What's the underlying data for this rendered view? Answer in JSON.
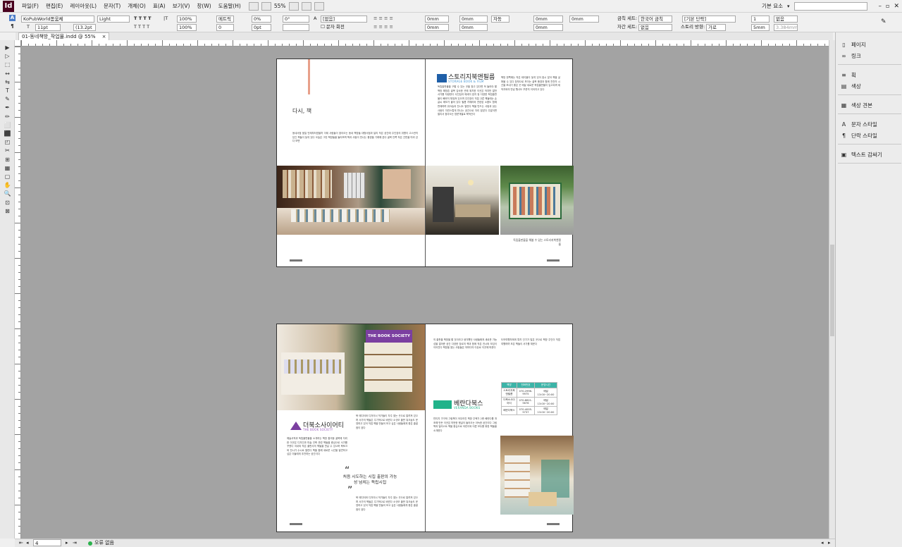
{
  "app": {
    "logo": "Id",
    "workspace": "기본 요소",
    "search_placeholder": "",
    "zoom": "55%"
  },
  "menu": [
    "파일(F)",
    "편집(E)",
    "레이아웃(L)",
    "문자(T)",
    "개체(O)",
    "표(A)",
    "보기(V)",
    "창(W)",
    "도움말(H)"
  ],
  "control": {
    "font_family": "KoPubWorld돋움체",
    "font_style": "Light",
    "font_size": "11pt",
    "leading": "(13.2pt",
    "scale_v": "100%",
    "scale_h": "100%",
    "kerning": "메트릭",
    "tracking": "0",
    "tsume": "0%",
    "baseline": "0pt",
    "skew": "0°",
    "lang_label": "A",
    "lang_value": "[없음]",
    "char_rotate": "문자 회전",
    "indent_left": "0mm",
    "indent_right": "0mm",
    "indent_first": "0mm",
    "indent_last": "0mm",
    "auto": "자동",
    "space_before": "0mm",
    "space_after": "0mm",
    "extra1": "0mm",
    "extra2": "0mm",
    "kinsoku_label": "금칙 세트:",
    "kinsoku_value": "한국어 금칙",
    "mojikumi_label": "자간 세트:",
    "mojikumi_value": "없음",
    "para_style": "[기본 단락]",
    "story_label": "스토리 방향:",
    "story_value": "가로",
    "columns": "1",
    "gutter": "5mm",
    "none": "없음",
    "width_val": "3.384mm"
  },
  "document": {
    "tab": "01-동네책방_작업물.indd @ 55%"
  },
  "tools": [
    "▶",
    "▷",
    "⬚",
    "↔",
    "⇆",
    "T",
    "✎",
    "✒",
    "✏",
    "⬜",
    "⬛",
    "◰",
    "✂",
    "⊞",
    "▦",
    "▢",
    "✋",
    "🔍",
    "⊡",
    "⊠"
  ],
  "panels": {
    "groups": [
      [
        {
          "icon": "▯",
          "label": "페이지"
        },
        {
          "icon": "∞",
          "label": "링크"
        }
      ],
      [
        {
          "icon": "≡",
          "label": "획"
        },
        {
          "icon": "▤",
          "label": "색상"
        }
      ],
      [
        {
          "icon": "▦",
          "label": "색상 견본"
        }
      ],
      [
        {
          "icon": "A",
          "label": "문자 스타일"
        },
        {
          "icon": "¶",
          "label": "단락 스타일"
        }
      ],
      [
        {
          "icon": "▣",
          "label": "텍스트 감싸기"
        }
      ]
    ]
  },
  "spread1": {
    "title": "다시, 책",
    "intro": "동네서점 붐일 언제부터였을까 이제 사람들이 찾아오는 동네 책방들 대형서점과 달리 작은 공간에 주인장의 취향이 고스란히 담긴 책들이 놓여 있다 오늘은 그런 책방들을 둘러보며 책과 사람이 만나는 풍경을 기록해 본다 골목 안쪽 작은 간판을 따라 걷다 보면",
    "store1_name": "스토리지북앤필름",
    "store1_sub": "STORAGE BOOK & FILM",
    "store1_text": "독립출판물을 구할 수 있는 곳을 찾고 있다면 꼭 들러야 할 책방 해방촌 골목 깊숙한 곳에 위치한 이곳은 작지만 알찬 서가를 자랑한다 사진집과 에세이 잡지 등 다양한 독립출판물이 빼곡히 채워져 있으며 주인장이 직접 고른 책들에는 손글씨 메모가 붙어 있다 필름 카메라와 관련된 소품도 함께 판매하며 워크숍과 전시도 열린다 책을 만드는 사람과 읽는 사람이 자연스럽게 만나는 공간으로 자리 잡았다 주말이면 멀리서 찾아오는 방문객들로 북적인다",
    "store1_text2": "책방 한쪽에는 작은 테이블이 놓여 있어 잠시 앉아 책을 살펴볼 수 있다 창밖으로 보이는 골목 풍경과 함께 천천히 시간을 보내기 좋은 곳 매달 새로운 독립출판물이 입고되며 제작자와의 만남 행사도 꾸준히 이어지고 있다",
    "caption": "독립출판물을 해볼 수 있는 스토리지북앤필름"
  },
  "spread2": {
    "badge": "THE BOOK SOCIETY",
    "store2_name": "더북소사이어티",
    "store2_sub": "THE BOOK SOCIETY",
    "store2_text": "예술서적과 독립출판물을 소개하는 책방 통의동 골목에 자리한 이곳은 디자인과 미술 건축 관련 책들을 중심으로 서가를 꾸렸다 국내외 작은 출판사의 책들을 만날 수 있으며 북토크와 전시가 수시로 열린다 책을 통해 새로운 시선을 발견하고 싶은 이들에게 추천하는 공간이다",
    "store2_text2": "북 에디터와 디자이너 작가들이 자주 찾는 곳으로 알려져 있으며 서가의 책들은 주기적으로 바뀐다 소규모 출판 워크숍도 운영하고 있어 직접 책을 만들어 보고 싶은 사람들에게 좋은 출발점이 된다",
    "quote": "처음 시도하는 시집 출판의 가능성 넘치는 독립시집",
    "mid_text": "의 출판을 책방을 할 것이라고 생각했던 사람들에게 새로운 가능성을 열어준 공간 다양한 장르의 책과 함께 작은 전시와 모임이 이어진다 책방을 찾는 사람들은 저마다의 이유로 이곳에 머문다",
    "store3_name": "베란다북스",
    "store3_sub": "VERANDA BOOKS",
    "store3_text": "빈티지 가구와 그림책이 어우러진 책방 주택가 2층 베란다를 개조해 만든 이곳은 따뜻한 햇살이 들어오는 아늑한 공간이다 그림책과 일러스트 책을 중심으로 어린이와 어른 모두를 위한 책들을 소개한다",
    "store3_text2": "도보여행자에게 특히 인기가 많은 곳으로 책방 주인이 직접 여행하며 모은 책들이 서가를 채운다",
    "table_headers": [
      "책방",
      "전화번호",
      "운영시간"
    ],
    "table_rows": [
      [
        "스토리지북앤필름",
        "070-2996-9975",
        "매일 13:00~20:00"
      ],
      [
        "더북소사이어티",
        "070-8621-5676",
        "매일 13:00~20:00"
      ],
      [
        "베란다북스",
        "070-4005-9737",
        "매일 13:00~20:00"
      ]
    ]
  },
  "status": {
    "page": "4",
    "errors": "오류 없음"
  },
  "colors": {
    "accent_pink": "#e8a08a",
    "purple": "#7b3fa0",
    "blue": "#1f5fa8",
    "green": "#21b38a",
    "teal": "#3cb4a8"
  }
}
